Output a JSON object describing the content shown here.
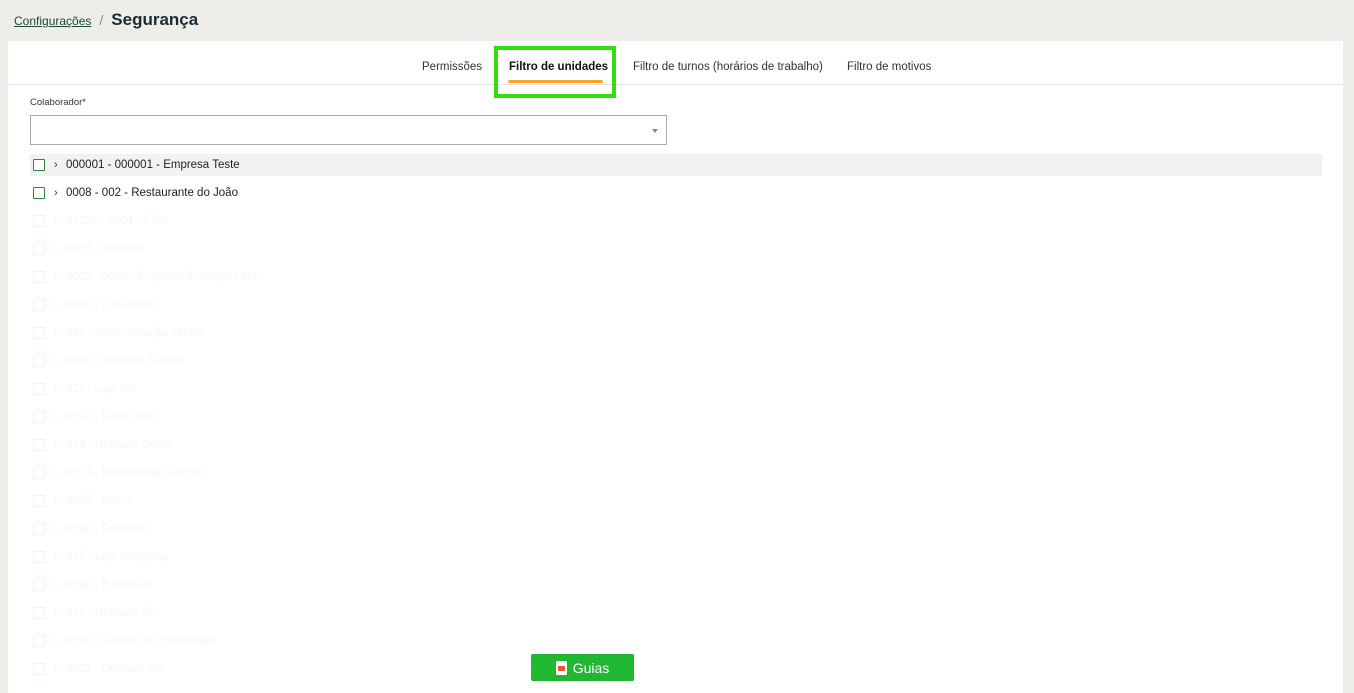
{
  "breadcrumb": {
    "parent": "Configurações",
    "separator": "/",
    "current": "Segurança"
  },
  "tabs": [
    {
      "label": "Permissões",
      "active": false
    },
    {
      "label": "Filtro de unidades",
      "active": true
    },
    {
      "label": "Filtro de turnos (horários de trabalho)",
      "active": false
    },
    {
      "label": "Filtro de motivos",
      "active": false
    }
  ],
  "collaborator": {
    "label": "Colaborador*",
    "value": ""
  },
  "tree": [
    {
      "label": "000001 - 000001 - Empresa Teste",
      "faded": false
    },
    {
      "label": "0008 - 002 - Restaurante do João",
      "faded": false
    },
    {
      "label": "01234 - 0001 - Filial",
      "faded": true
    },
    {
      "label": "0005 - Unidade",
      "faded": true
    },
    {
      "label": "0002 - 0003 - Empresa Exemplo Ltda",
      "faded": true
    },
    {
      "label": "0006 - Loja Norte",
      "faded": true
    },
    {
      "label": "010 - Administração central",
      "faded": true
    },
    {
      "label": "0009 - Unidade Centro",
      "faded": true
    },
    {
      "label": "011 - Loja Sul",
      "faded": true
    },
    {
      "label": "0012 - Filial Leste",
      "faded": true
    },
    {
      "label": "013 - Unidade Oeste",
      "faded": true
    },
    {
      "label": "0014 - Restaurante Centro",
      "faded": true
    },
    {
      "label": "0015 - Matriz",
      "faded": true
    },
    {
      "label": "0016 - Depósito",
      "faded": true
    },
    {
      "label": "017 - Loja Shopping",
      "faded": true
    },
    {
      "label": "0018 - Escritório",
      "faded": true
    },
    {
      "label": "019 - Unidade Rio",
      "faded": true
    },
    {
      "label": "0020 - Centro de Distribuição",
      "faded": true
    },
    {
      "label": "0021 - Unidade Sul",
      "faded": true
    }
  ],
  "guides_button": {
    "label": "Guias",
    "icon": "document-icon"
  },
  "colors": {
    "accent_underline": "#f5a623",
    "highlight_box": "#2ee00f",
    "button_green": "#20b733",
    "checkbox_green": "#2f8a3c"
  }
}
